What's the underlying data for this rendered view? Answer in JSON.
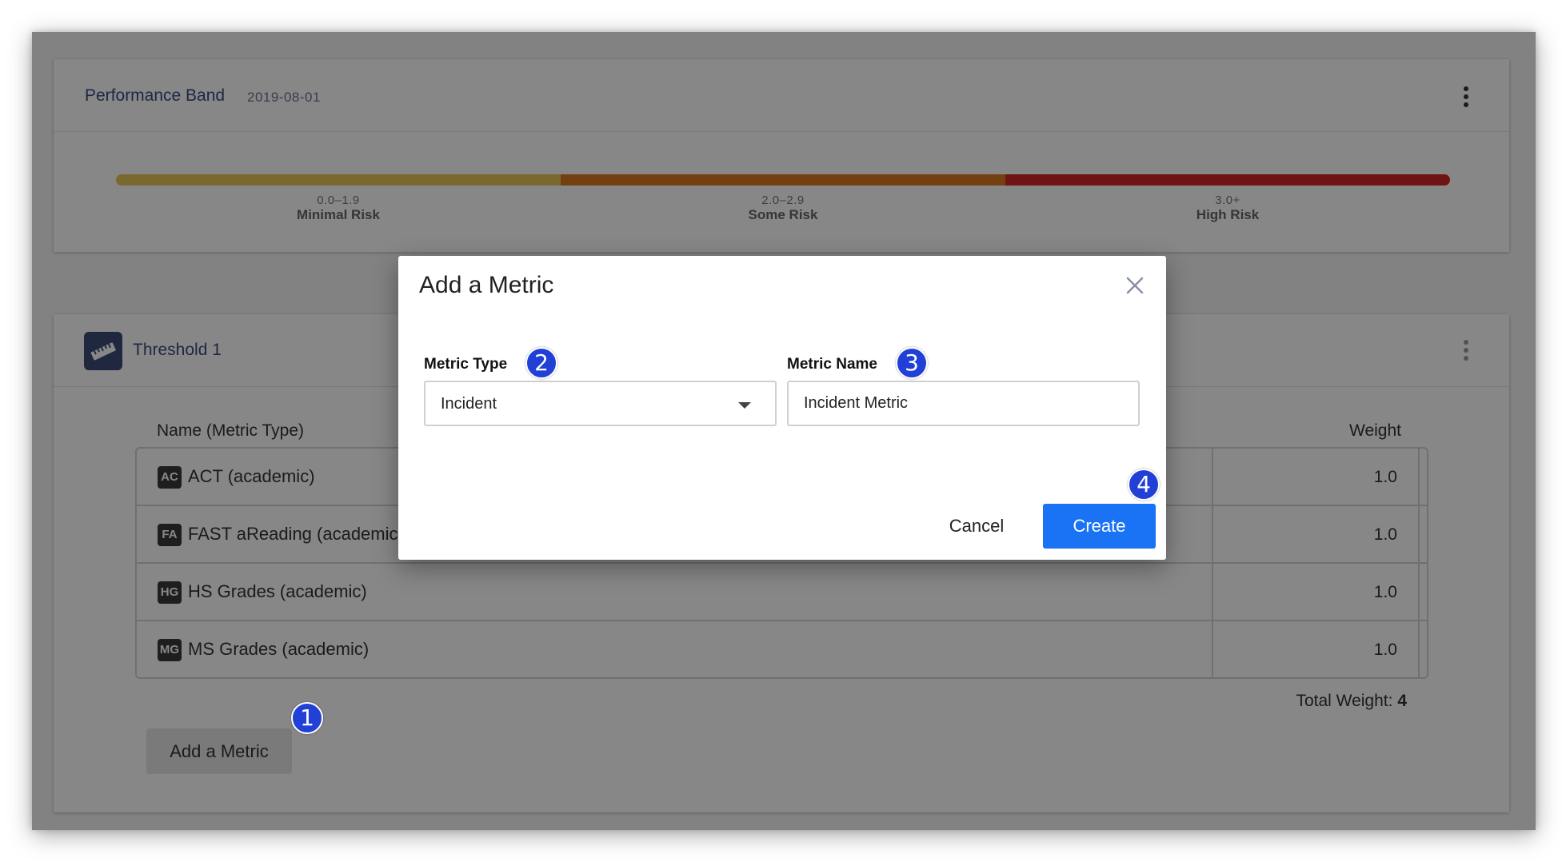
{
  "performance_band": {
    "title": "Performance Band",
    "date": "2019-08-01",
    "bands": [
      {
        "range": "0.0–1.9",
        "label": "Minimal Risk",
        "color": "#e6c45a"
      },
      {
        "range": "2.0–2.9",
        "label": "Some Risk",
        "color": "#dd7a1d"
      },
      {
        "range": "3.0+",
        "label": "High Risk",
        "color": "#d42424"
      }
    ]
  },
  "threshold": {
    "title": "Threshold 1",
    "icon": "ruler-icon",
    "columns": {
      "name": "Name (Metric Type)",
      "weight": "Weight"
    },
    "rows": [
      {
        "abbr": "AC",
        "name": "ACT (academic)",
        "weight": "1.0"
      },
      {
        "abbr": "FA",
        "name": "FAST aReading (academic)",
        "weight": "1.0"
      },
      {
        "abbr": "HG",
        "name": "HS Grades (academic)",
        "weight": "1.0"
      },
      {
        "abbr": "MG",
        "name": "MS Grades (academic)",
        "weight": "1.0"
      }
    ],
    "total_weight_label": "Total Weight:",
    "total_weight_value": "4",
    "add_metric_label": "Add a Metric"
  },
  "dialog": {
    "title": "Add a Metric",
    "metric_type_label": "Metric Type",
    "metric_type_value": "Incident",
    "metric_name_label": "Metric Name",
    "metric_name_value": "Incident Metric",
    "cancel_label": "Cancel",
    "create_label": "Create"
  },
  "callouts": [
    "1",
    "2",
    "3",
    "4"
  ],
  "colors": {
    "accent": "#1a73f5",
    "callout": "#2140d6",
    "nav_title": "#3c4b7d"
  }
}
